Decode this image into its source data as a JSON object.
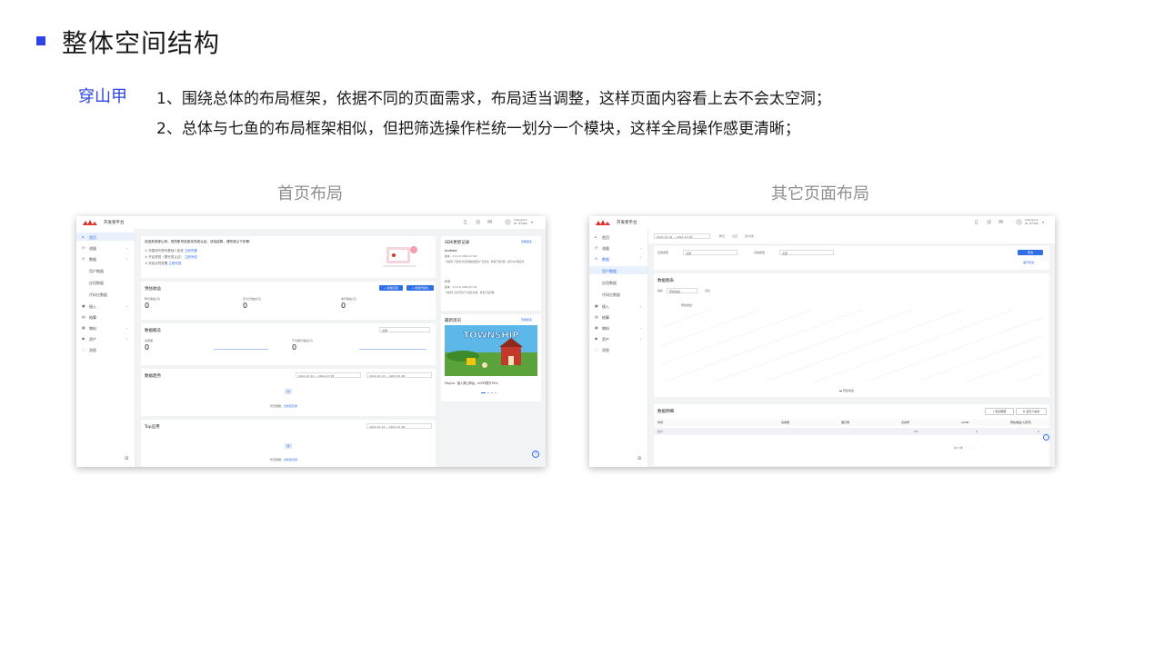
{
  "title": "整体空间结构",
  "brand": "穿山甲",
  "description": [
    "1、围绕总体的布局框架，依据不同的页面需求，布局适当调整，这样页面内容看上去不会太空洞；",
    "2、总体与七鱼的布局框架相似，但把筛选操作栏统一划分一个模块，这样全局操作感更清晰；"
  ],
  "captions": {
    "home": "首页布局",
    "other": "其它页面布局"
  },
  "colors": {
    "accent": "#2f45e6",
    "primary_button": "#2f6fe6",
    "logo": "#e0322d"
  },
  "home_shot": {
    "platform": "开发者平台",
    "user": [
      "zhangxxx",
      "ID: 87364"
    ],
    "sidebar": [
      {
        "label": "首页",
        "active": true
      },
      {
        "label": "流量",
        "chevron": true
      },
      {
        "label": "数据",
        "chevron": true
      },
      {
        "label": "用户数据",
        "sub": true
      },
      {
        "label": "应用数据",
        "sub": true
      },
      {
        "label": "代码位数据",
        "sub": true
      },
      {
        "label": "接入",
        "chevron": true
      },
      {
        "label": "结算"
      },
      {
        "label": "物料",
        "chevron": true
      },
      {
        "label": "资产",
        "chevron": true
      },
      {
        "label": "消息"
      }
    ],
    "welcome": {
      "title": "欢迎来到穿山甲。您的账号信息未完成认证，涉及结算，请完成以下步骤：",
      "steps": [
        "完整填写账号基础人信息",
        "开启提现（需完成认证）",
        "完成合同签署"
      ],
      "step_links": [
        "立即完善",
        "立即完成",
        "立即完成"
      ]
    },
    "income": {
      "title": "预估收益",
      "buttons": [
        "+ 新建应用",
        "+ 新建代码位"
      ],
      "labels": [
        "昨日收益(元)",
        "近七日收益(元)",
        "本月收益(元)"
      ],
      "values": [
        "0",
        "0",
        "0"
      ]
    },
    "overview": {
      "title": "数据概览",
      "select": "全部",
      "labels": [
        "请求量",
        "千次展示收益(元)"
      ],
      "values": [
        "0",
        "0"
      ]
    },
    "trend": {
      "title": "数据趋势",
      "dates": [
        "2021-07-22 ~ 2021-07-28",
        "2021-07-22 ~ 2021-07-28"
      ],
      "empty": "暂无数据，",
      "empty_link": "去新建应用"
    },
    "top": {
      "title": "Top应用",
      "dates": "2021-07-22 ~ 2021-07-28",
      "empty": "暂无数据，",
      "empty_link": "去新建应用"
    },
    "sdk": {
      "title": "SDK更新记录",
      "more": "查看更多",
      "entries": [
        {
          "platform": "Android",
          "version": "版本：3.4.1.0    2021-07-16",
          "text": "【新增】开屏/信息流/激励视频等广告优化，修复已知问题，提升SDK稳定性"
        },
        {
          "platform": "iOS",
          "version": "版本：3.4.1.0    2021-07-16",
          "text": "【新增】优化开屏广告展示性能，修复已知问题"
        }
      ]
    },
    "news": {
      "title": "最新资讯",
      "more": "查看更多",
      "game": "TOWNSHIP",
      "caption": "Playrix：接入穿山甲后，eCPM提升35%"
    }
  },
  "other_shot": {
    "platform": "开发者平台",
    "user": [
      "zhangxxx",
      "ID: 87364"
    ],
    "sidebar": [
      {
        "label": "首页"
      },
      {
        "label": "流量",
        "chevron": true
      },
      {
        "label": "数据",
        "chevron": true,
        "open": true
      },
      {
        "label": "用户数据",
        "sub": true,
        "active": true
      },
      {
        "label": "应用数据",
        "sub": true
      },
      {
        "label": "代码位数据",
        "sub": true
      },
      {
        "label": "接入",
        "chevron": true
      },
      {
        "label": "结算"
      },
      {
        "label": "物料",
        "chevron": true
      },
      {
        "label": "资产",
        "chevron": true
      },
      {
        "label": "消息"
      }
    ],
    "filter": {
      "date": "2021-07-22 ~ 2021-07-28",
      "tags": [
        "昨日",
        "七日",
        "近30天"
      ],
      "labels": [
        "应用类型",
        "系统类型"
      ],
      "placeholders": [
        "全部",
        "全部"
      ],
      "button": "查询",
      "reset": "展开筛选"
    },
    "chart_panel": {
      "title": "数据图表",
      "metric_label": "指标",
      "metric": "预估收益",
      "compare": "对比",
      "legend": "预估收益"
    },
    "table": {
      "title": "数据明细",
      "buttons": [
        "导出明细",
        "自定义指标"
      ],
      "headers": [
        "时间",
        "请求量",
        "展示量",
        "点击率",
        "eCPM",
        "预估收益(人民币)"
      ],
      "rows": [
        [
          "总计",
          "-",
          "-",
          "0%",
          "0",
          "0"
        ]
      ],
      "pagination": "共 0 条"
    }
  }
}
